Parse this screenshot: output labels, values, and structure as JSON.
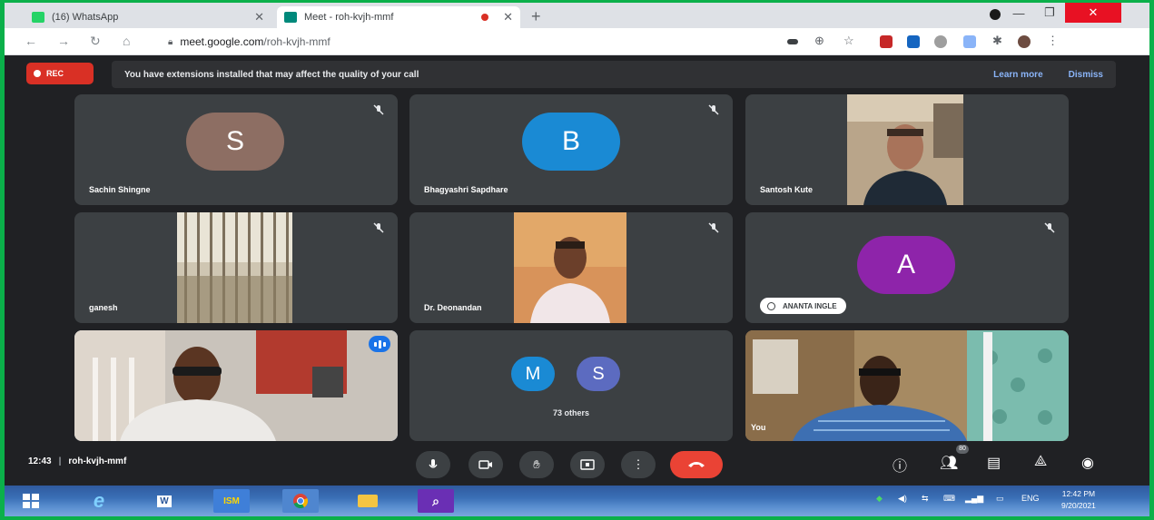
{
  "browser": {
    "tabs": [
      {
        "title": "(16) WhatsApp",
        "favicon": "whatsapp-icon",
        "color": "#25d366",
        "active": false
      },
      {
        "title": "Meet - roh-kvjh-mmf",
        "favicon": "meet-icon",
        "color": "#00897b",
        "active": true
      }
    ],
    "address": {
      "host": "meet.google.com",
      "path": "/roh-kvjh-mmf"
    }
  },
  "meet": {
    "rec_label": "REC",
    "banner": {
      "message": "You have extensions installed that may affect the quality of your call",
      "learn_more": "Learn more",
      "dismiss": "Dismiss"
    },
    "tiles": [
      {
        "name": "Sachin Shingne",
        "initial": "S",
        "avatar_color": "#8d6e63",
        "kind": "avatar"
      },
      {
        "name": "Bhagyashri Sapdhare",
        "initial": "B",
        "avatar_color": "#1a8ad4",
        "kind": "avatar"
      },
      {
        "name": "Santosh Kute",
        "kind": "video"
      },
      {
        "name": "ganesh",
        "kind": "video"
      },
      {
        "name": "Dr. Deonandan",
        "kind": "video"
      },
      {
        "name": "ANANTA INGLE",
        "initial": "A",
        "avatar_color": "#8e24aa",
        "kind": "avatar"
      },
      {
        "name": "",
        "kind": "video",
        "speaking": true
      },
      {
        "others_label": "73 others",
        "initials": [
          "M",
          "S"
        ],
        "colors": [
          "#1a8ad4",
          "#5c6bc0"
        ],
        "kind": "others"
      },
      {
        "name": "You",
        "kind": "video"
      }
    ],
    "footer": {
      "time": "12:43",
      "code": "roh-kvjh-mmf",
      "participants_count": "80"
    }
  },
  "taskbar": {
    "clock_time": "12:42 PM",
    "clock_date": "9/20/2021",
    "language": "ENG",
    "ism_label": "ISM"
  }
}
